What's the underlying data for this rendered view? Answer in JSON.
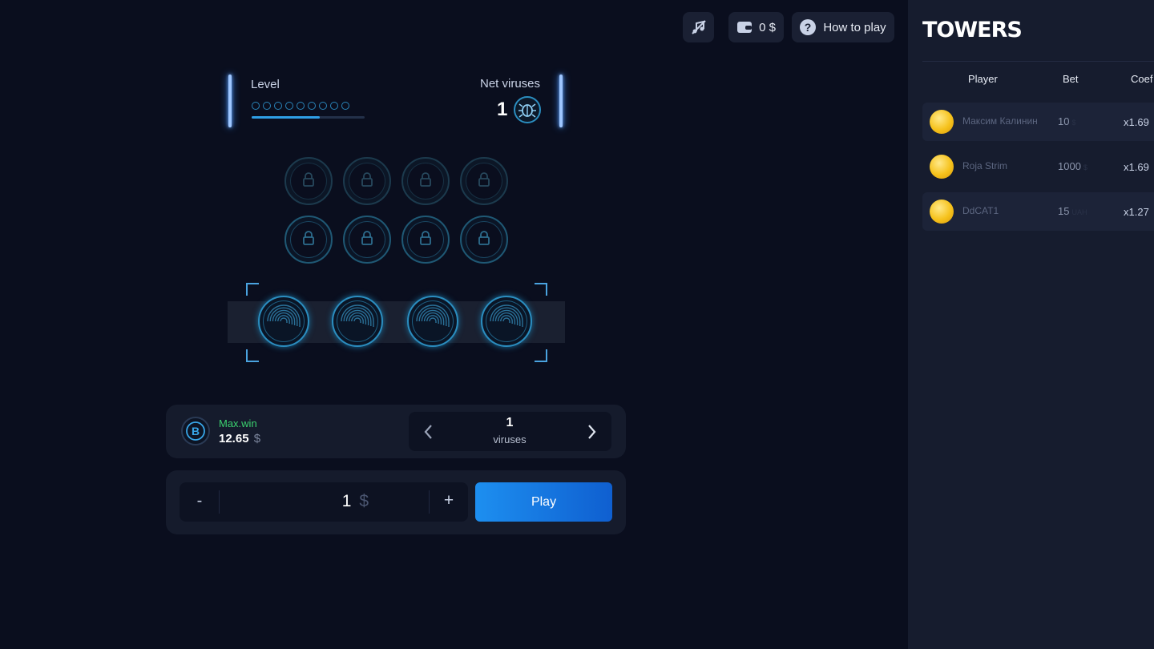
{
  "topbar": {
    "sound_icon": "music-muted-icon",
    "wallet_icon": "wallet-icon",
    "balance": "0 $",
    "help_icon": "question-icon",
    "how_to_play": "How to play"
  },
  "level": {
    "label": "Level",
    "steps_total": 9,
    "progress": 0.6
  },
  "net_viruses": {
    "label": "Net viruses",
    "count": "1",
    "icon": "virus-bug-icon"
  },
  "grid": {
    "locked_rows": 2,
    "columns": 4,
    "lock_icon": "lock-icon",
    "fingerprint_icon": "fingerprint-icon"
  },
  "maxwin": {
    "icon": "bitcoin-icon",
    "label": "Max.win",
    "value": "12.65",
    "currency": "$"
  },
  "viruses_selector": {
    "value": "1",
    "unit": "viruses",
    "prev_icon": "chevron-left-icon",
    "next_icon": "chevron-right-icon"
  },
  "bet": {
    "minus": "-",
    "value": "1",
    "currency": "$",
    "plus": "+",
    "play": "Play"
  },
  "sidebar": {
    "logo": "TOWERS",
    "headers": {
      "player": "Player",
      "bet": "Bet",
      "coef": "Coef"
    },
    "rows": [
      {
        "player": "Максим Калинин",
        "bet": "10",
        "currency": "$",
        "coef": "x1.69"
      },
      {
        "player": "Roja Strim",
        "bet": "1000",
        "currency": "$",
        "coef": "x1.69"
      },
      {
        "player": "DdCAT1",
        "bet": "15",
        "currency": "UAH",
        "coef": "x1.27"
      }
    ]
  },
  "colors": {
    "background": "#0a0e1e",
    "accent": "#1d8ff0",
    "cyan": "#2b8dbf",
    "maxwin_green": "#3bd16f"
  }
}
